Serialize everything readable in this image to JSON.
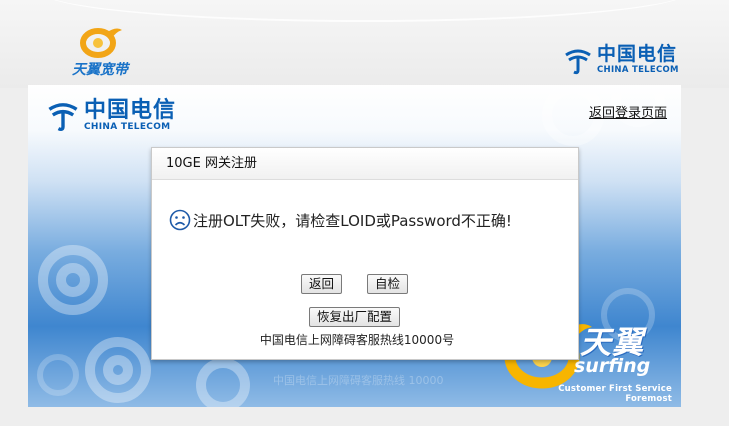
{
  "header": {
    "brand_left": "天翼宽带",
    "ct_logo_cn": "中国电信",
    "ct_logo_en": "CHINA TELECOM"
  },
  "panel": {
    "ct_logo_cn": "中国电信",
    "ct_logo_en": "CHINA TELECOM",
    "return_login_link": "返回登录页面"
  },
  "dialog": {
    "title": "10GE  网关注册",
    "message": "注册OLT失败，请检查LOID或Password不正确!",
    "back_button": "返回",
    "selfcheck_button": "自检",
    "reset_button": "恢复出厂配置",
    "hotline": "中国电信上网障碍客服热线10000号"
  },
  "footer": {
    "faded_text": "中国电信上网障碍客服热线 10000",
    "surfing_cn": "天翼",
    "surfing_en": "surfing",
    "tagline": "Customer First Service Foremost"
  },
  "icons": {
    "brand_logo": "tianyi-logo-icon",
    "ct_logo": "china-telecom-logo-icon",
    "message_icon": "sad-face-icon",
    "surfing_logo": "surfing-swirl-icon"
  },
  "colors": {
    "brand_blue": "#0a5fb4",
    "tianyi_orange": "#f2a516",
    "panel_blue": "#3f86cf"
  }
}
